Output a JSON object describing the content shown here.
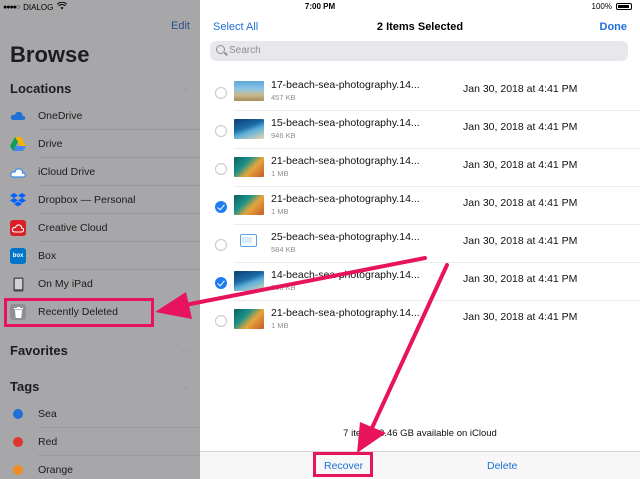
{
  "status": {
    "carrier": "DIALOG",
    "time": "7:00 PM",
    "battery": "100%"
  },
  "sidebar": {
    "edit": "Edit",
    "title": "Browse",
    "locations_header": "Locations",
    "locations": [
      {
        "label": "OneDrive",
        "icon": "onedrive-icon",
        "color": "#1e6fd6"
      },
      {
        "label": "Drive",
        "icon": "google-drive-icon",
        "color": "#f4b400"
      },
      {
        "label": "iCloud Drive",
        "icon": "icloud-icon",
        "color": "#3a8ee6"
      },
      {
        "label": "Dropbox — Personal",
        "icon": "dropbox-icon",
        "color": "#0061fe"
      },
      {
        "label": "Creative Cloud",
        "icon": "creative-cloud-icon",
        "color": "#da1f26"
      },
      {
        "label": "Box",
        "icon": "box-icon",
        "color": "#0075c9"
      },
      {
        "label": "On My iPad",
        "icon": "ipad-icon",
        "color": "#555"
      },
      {
        "label": "Recently Deleted",
        "icon": "trash-icon",
        "color": "#8e8e93"
      }
    ],
    "favorites_header": "Favorites",
    "tags_header": "Tags",
    "tags": [
      {
        "label": "Sea",
        "color": "#1e6fd6"
      },
      {
        "label": "Red",
        "color": "#e0342f"
      },
      {
        "label": "Orange",
        "color": "#f08a24"
      }
    ]
  },
  "main": {
    "select_all": "Select All",
    "title": "2 Items Selected",
    "done": "Done",
    "search_placeholder": "Search",
    "files": [
      {
        "name": "17-beach-sea-photography.14...",
        "size": "457 KB",
        "date": "Jan 30, 2018 at 4:41 PM",
        "selected": false,
        "thumb": "t-beach1"
      },
      {
        "name": "15-beach-sea-photography.14...",
        "size": "946 KB",
        "date": "Jan 30, 2018 at 4:41 PM",
        "selected": false,
        "thumb": "t-beach2"
      },
      {
        "name": "21-beach-sea-photography.14...",
        "size": "1 MB",
        "date": "Jan 30, 2018 at 4:41 PM",
        "selected": false,
        "thumb": "t-beach3"
      },
      {
        "name": "21-beach-sea-photography.14...",
        "size": "1 MB",
        "date": "Jan 30, 2018 at 4:41 PM",
        "selected": true,
        "thumb": "t-beach3"
      },
      {
        "name": "25-beach-sea-photography.14...",
        "size": "584 KB",
        "date": "Jan 30, 2018 at 4:41 PM",
        "selected": false,
        "thumb": "t-doc"
      },
      {
        "name": "14-beach-sea-photography.14...",
        "size": "830 KB",
        "date": "Jan 30, 2018 at 4:41 PM",
        "selected": true,
        "thumb": "t-beach2"
      },
      {
        "name": "21-beach-sea-photography.14...",
        "size": "1 MB",
        "date": "Jan 30, 2018 at 4:41 PM",
        "selected": false,
        "thumb": "t-beach3"
      }
    ],
    "storage_text": "7 items, 3.46 GB available on iCloud",
    "recover": "Recover",
    "delete": "Delete"
  },
  "annotation_color": "#e8135d"
}
